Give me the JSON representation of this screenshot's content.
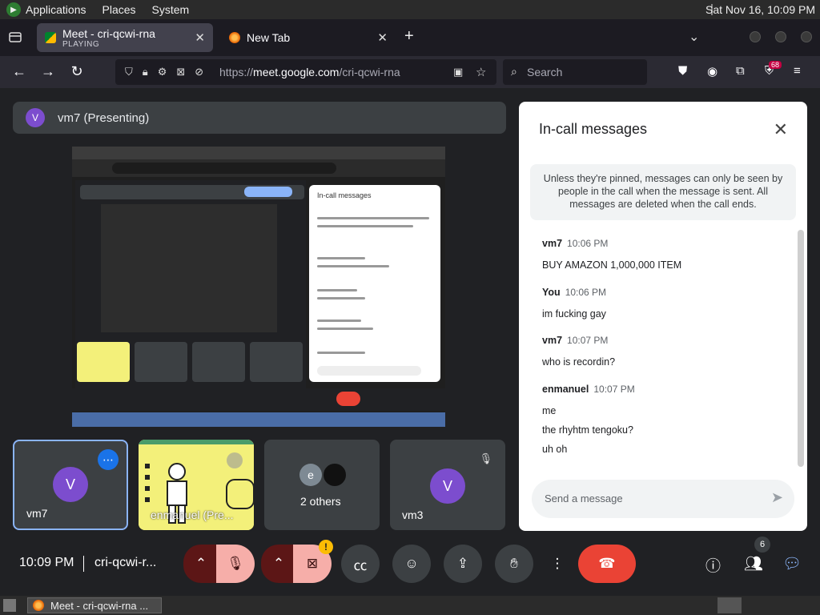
{
  "system_panel": {
    "menus": [
      "Applications",
      "Places",
      "System"
    ],
    "clock": "Sat Nov 16, 10:09 PM"
  },
  "browser": {
    "tabs": [
      {
        "title": "Meet - cri-qcwi-rna",
        "subtitle": "PLAYING",
        "active": true
      },
      {
        "title": "New Tab",
        "subtitle": "",
        "active": false
      }
    ],
    "url_prefix": "https://",
    "url_host": "meet.google.com",
    "url_path": "/cri-qcwi-rna",
    "search_placeholder": "Search",
    "extensions_badge": "68"
  },
  "meet": {
    "presenting": {
      "avatar_letter": "V",
      "label": "vm7 (Presenting)"
    },
    "shared_screen": {
      "inner_chat_title": "In-call messages"
    },
    "tiles": [
      {
        "name": "vm7",
        "avatar_letter": "V",
        "selected": true,
        "menu_icon": "more-dots-icon"
      },
      {
        "name": "enmanuel (Pre...",
        "type": "game"
      },
      {
        "name": "2 others",
        "avatar_letter": "e"
      },
      {
        "name": "vm3",
        "avatar_letter": "V",
        "muted": true
      }
    ],
    "controls": {
      "time": "10:09 PM",
      "code": "cri-qcwi-r...",
      "camera_warning": "!",
      "participants_count": "6"
    },
    "chat": {
      "title": "In-call messages",
      "notice": "Unless they're pinned, messages can only be seen by people in the call when the message is sent. All messages are deleted when the call ends.",
      "messages": [
        {
          "sender": "vm7",
          "time": "10:06 PM",
          "lines": [
            "BUY AMAZON 1,000,000 ITEM"
          ]
        },
        {
          "sender": "You",
          "time": "10:06 PM",
          "lines": [
            "im fucking gay"
          ]
        },
        {
          "sender": "vm7",
          "time": "10:07 PM",
          "lines": [
            "who is recordin?"
          ]
        },
        {
          "sender": "enmanuel",
          "time": "10:07 PM",
          "lines": [
            "me",
            "the rhyhtm tengoku?",
            "uh oh"
          ]
        }
      ],
      "input_placeholder": "Send a message"
    }
  },
  "taskbar": {
    "window_title": "Meet - cri-qcwi-rna ..."
  },
  "colors": {
    "accent": "#8ab4f8",
    "leave": "#ea4335",
    "avatar": "#7c4dce",
    "warn": "#fbbc04"
  }
}
